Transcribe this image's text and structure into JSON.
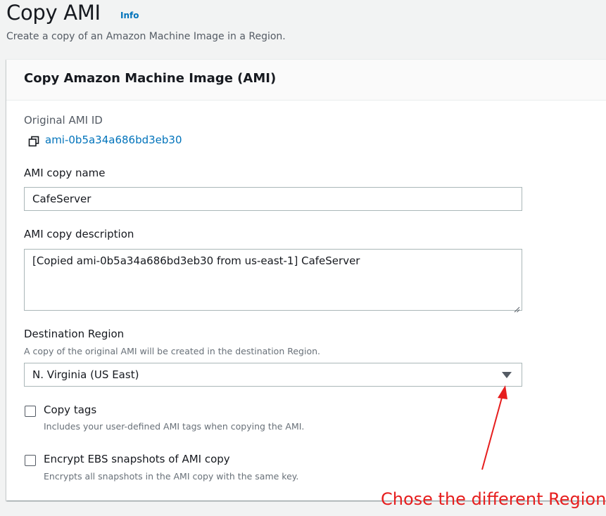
{
  "page": {
    "title": "Copy AMI",
    "info_link": "Info",
    "description": "Create a copy of an Amazon Machine Image in a Region."
  },
  "panel": {
    "title": "Copy Amazon Machine Image (AMI)"
  },
  "original_ami": {
    "label": "Original AMI ID",
    "value": "ami-0b5a34a686bd3eb30",
    "icon": "copy-icon"
  },
  "ami_copy_name": {
    "label": "AMI copy name",
    "value": "CafeServer"
  },
  "ami_copy_description": {
    "label": "AMI copy description",
    "value": "[Copied ami-0b5a34a686bd3eb30 from us-east-1] CafeServer"
  },
  "destination_region": {
    "label": "Destination Region",
    "hint": "A copy of the original AMI will be created in the destination Region.",
    "selected": "N. Virginia (US East)"
  },
  "copy_tags": {
    "label": "Copy tags",
    "hint": "Includes your user-defined AMI tags when copying the AMI.",
    "checked": false
  },
  "encrypt": {
    "label": "Encrypt EBS snapshots of AMI copy",
    "hint": "Encrypts all snapshots in the AMI copy with the same key.",
    "checked": false
  },
  "annotation": {
    "text": "Chose the different Region",
    "color": "#e61e1e"
  },
  "colors": {
    "link": "#0073bb",
    "background": "#f2f3f3",
    "panel": "#ffffff"
  }
}
